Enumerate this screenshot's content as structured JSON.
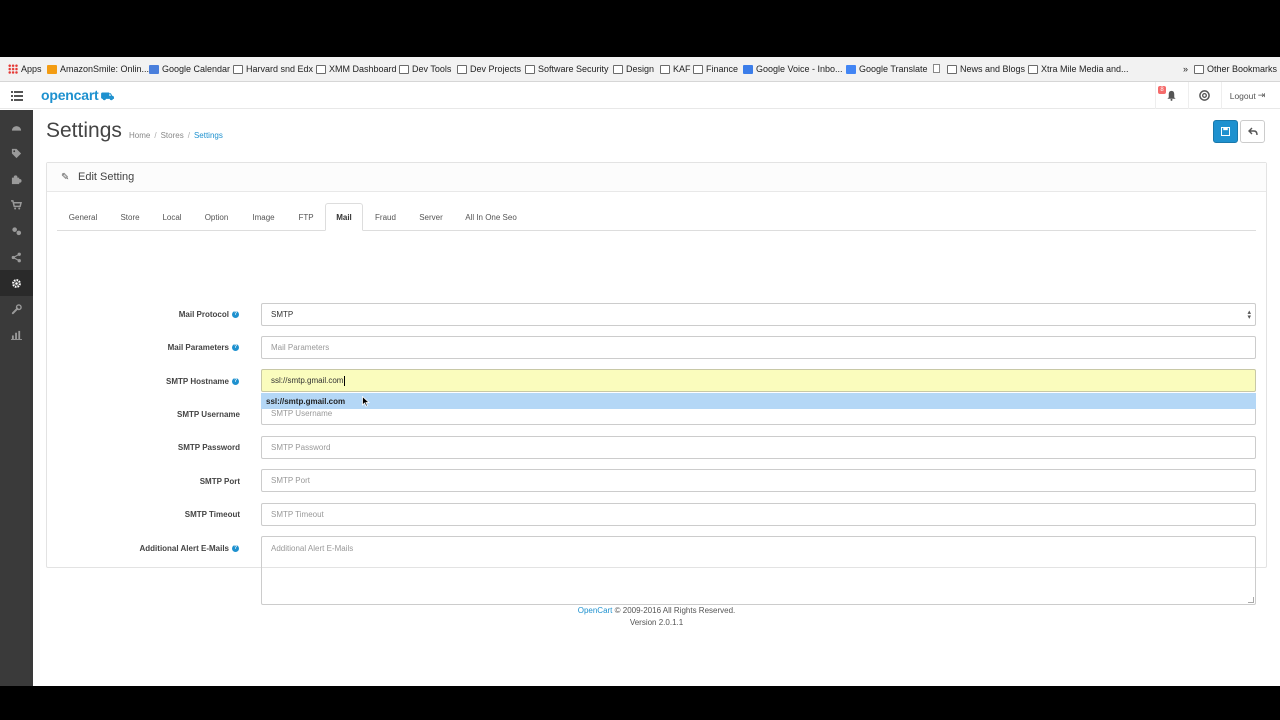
{
  "bookmarks": [
    {
      "label": "Apps",
      "icon": "apps-grid-icon"
    },
    {
      "label": "AmazonSmile: Onlin...",
      "icon": "amazon-icon"
    },
    {
      "label": "Google Calendar",
      "icon": "calendar-icon"
    },
    {
      "label": "Harvard snd Edx",
      "icon": "folder-icon"
    },
    {
      "label": "XMM Dashboard",
      "icon": "folder-icon"
    },
    {
      "label": "Dev Tools",
      "icon": "folder-icon"
    },
    {
      "label": "Dev Projects",
      "icon": "folder-icon"
    },
    {
      "label": "Software Security",
      "icon": "folder-icon"
    },
    {
      "label": "Design",
      "icon": "folder-icon"
    },
    {
      "label": "KAF",
      "icon": "folder-icon"
    },
    {
      "label": "Finance",
      "icon": "folder-icon"
    },
    {
      "label": "Google Voice - Inbo...",
      "icon": "google-voice-icon"
    },
    {
      "label": "Google Translate",
      "icon": "google-translate-icon"
    },
    {
      "label": "",
      "icon": "page-icon"
    },
    {
      "label": "News and Blogs",
      "icon": "folder-icon"
    },
    {
      "label": "Xtra Mile Media and...",
      "icon": "folder-icon"
    },
    {
      "label": "Other Bookmarks",
      "icon": "folder-icon"
    }
  ],
  "header": {
    "logo": "opencart",
    "notification_count": "8",
    "logout": "Logout"
  },
  "sidebar": [
    "dashboard-icon",
    "tags-icon",
    "puzzle-icon",
    "cart-icon",
    "users-icon",
    "share-icon",
    "cog-icon",
    "wrench-icon",
    "bar-chart-icon"
  ],
  "page": {
    "title": "Settings",
    "breadcrumb": [
      "Home",
      "Stores",
      "Settings"
    ]
  },
  "panel": {
    "heading": "Edit Setting",
    "tabs": [
      "General",
      "Store",
      "Local",
      "Option",
      "Image",
      "FTP",
      "Mail",
      "Fraud",
      "Server",
      "All In One Seo"
    ],
    "active_tab": "Mail"
  },
  "form": {
    "mail_protocol": {
      "label": "Mail Protocol",
      "value": "SMTP"
    },
    "mail_parameters": {
      "label": "Mail Parameters",
      "placeholder": "Mail Parameters"
    },
    "smtp_hostname": {
      "label": "SMTP Hostname",
      "value": "ssl://smtp.gmail.com"
    },
    "autocomplete_suggestion": "ssl://smtp.gmail.com",
    "smtp_username": {
      "label": "SMTP Username",
      "placeholder": "SMTP Username"
    },
    "smtp_password": {
      "label": "SMTP Password",
      "placeholder": "SMTP Password"
    },
    "smtp_port": {
      "label": "SMTP Port",
      "placeholder": "SMTP Port"
    },
    "smtp_timeout": {
      "label": "SMTP Timeout",
      "placeholder": "SMTP Timeout"
    },
    "alert_emails": {
      "label": "Additional Alert E-Mails",
      "placeholder": "Additional Alert E-Mails"
    }
  },
  "footer": {
    "link": "OpenCart",
    "copyright": "© 2009-2016 All Rights Reserved.",
    "version": "Version 2.0.1.1"
  }
}
